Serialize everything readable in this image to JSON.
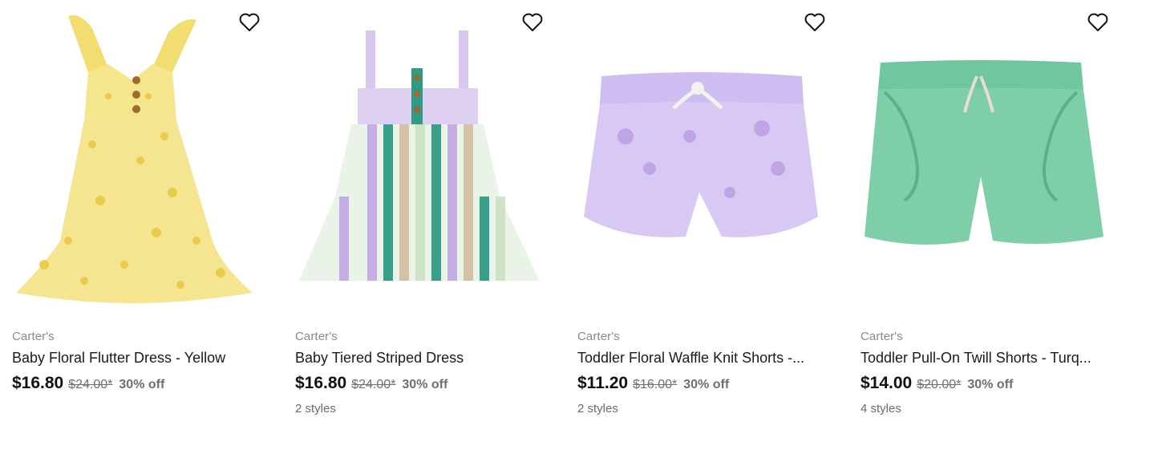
{
  "products": [
    {
      "brand": "Carter's",
      "title": "Baby Floral Flutter Dress - Yellow",
      "sale_price": "$16.80",
      "original_price": "$24.00*",
      "discount": "30% off",
      "styles": "",
      "image": "yellow-floral-dress",
      "colors": [
        "#f5e58a",
        "#e6c93f"
      ]
    },
    {
      "brand": "Carter's",
      "title": "Baby Tiered Striped Dress",
      "sale_price": "$16.80",
      "original_price": "$24.00*",
      "discount": "30% off",
      "styles": "2 styles",
      "image": "striped-tiered-dress",
      "colors": [
        "#c7b2e3",
        "#2f9b84",
        "#d6c3a3",
        "#cfe3c5"
      ]
    },
    {
      "brand": "Carter's",
      "title": "Toddler Floral Waffle Knit Shorts -...",
      "sale_price": "$11.20",
      "original_price": "$16.00*",
      "discount": "30% off",
      "styles": "2 styles",
      "image": "purple-floral-shorts",
      "colors": [
        "#d6c6f0",
        "#b9a2e3"
      ]
    },
    {
      "brand": "Carter's",
      "title": "Toddler Pull-On Twill Shorts - Turq...",
      "sale_price": "$14.00",
      "original_price": "$20.00*",
      "discount": "30% off",
      "styles": "4 styles",
      "image": "turquoise-twill-shorts",
      "colors": [
        "#7ecfa9",
        "#67b994"
      ]
    }
  ]
}
